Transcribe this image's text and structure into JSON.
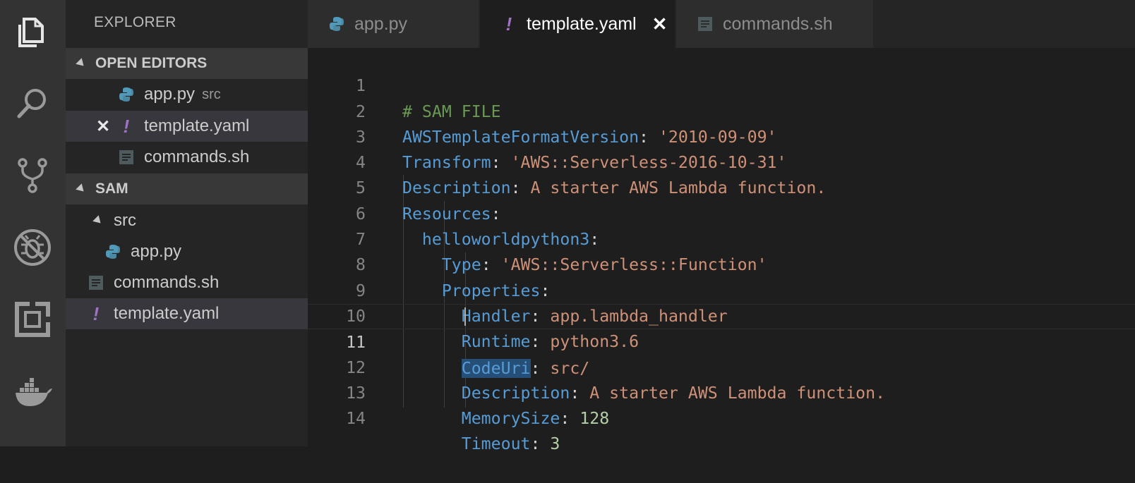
{
  "activity_bar": {
    "icons": [
      "files-icon",
      "search-icon",
      "source-control-icon",
      "debug-icon",
      "extensions-icon",
      "docker-icon"
    ]
  },
  "sidebar": {
    "title": "EXPLORER",
    "open_editors_header": "OPEN EDITORS",
    "open_editors": [
      {
        "label": "app.py",
        "desc": "src",
        "icon": "python-icon"
      },
      {
        "label": "template.yaml",
        "icon": "yaml-icon"
      },
      {
        "label": "commands.sh",
        "icon": "shell-file-icon"
      }
    ],
    "sam_header": "SAM",
    "folder_src": "src",
    "sam_files": [
      {
        "label": "app.py",
        "icon": "python-icon"
      },
      {
        "label": "commands.sh",
        "icon": "shell-file-icon"
      },
      {
        "label": "template.yaml",
        "icon": "yaml-icon"
      }
    ],
    "yaml_glyph": "!",
    "close_glyph": "✕"
  },
  "tabs": [
    {
      "label": "app.py",
      "icon": "python-icon"
    },
    {
      "label": "template.yaml",
      "icon": "yaml-icon",
      "active": true,
      "close": "✕"
    },
    {
      "label": "commands.sh",
      "icon": "shell-file-icon"
    }
  ],
  "editor": {
    "current_line": 11,
    "lines": [
      {
        "n": "1",
        "c": "# SAM FILE"
      },
      {
        "n": "2",
        "k": "AWSTemplateFormatVersion",
        "s": "'2010-09-09'"
      },
      {
        "n": "3",
        "k": "Transform",
        "s": "'AWS::Serverless-2016-10-31'"
      },
      {
        "n": "4",
        "k": "Description",
        "s": "A starter AWS Lambda function."
      },
      {
        "n": "5",
        "k": "Resources"
      },
      {
        "n": "6",
        "k": "helloworldpython3"
      },
      {
        "n": "7",
        "k": "Type",
        "s": "'AWS::Serverless::Function'"
      },
      {
        "n": "8",
        "k": "Properties"
      },
      {
        "n": "9",
        "k": "Handler",
        "s": "app.lambda_handler"
      },
      {
        "n": "10",
        "k": "Runtime",
        "s": "python3.6"
      },
      {
        "n": "11",
        "k": "CodeUri",
        "s": "src/"
      },
      {
        "n": "12",
        "k": "Description",
        "s": "A starter AWS Lambda function."
      },
      {
        "n": "13",
        "k": "MemorySize",
        "num": "128"
      },
      {
        "n": "14",
        "k": "Timeout",
        "num": "3"
      }
    ]
  },
  "colors": {
    "keyword": "#569cd6",
    "string": "#ce9178",
    "number": "#b5cea8",
    "comment": "#6a9955",
    "yaml_icon": "#a074c4",
    "python_icon": "#519aba"
  }
}
